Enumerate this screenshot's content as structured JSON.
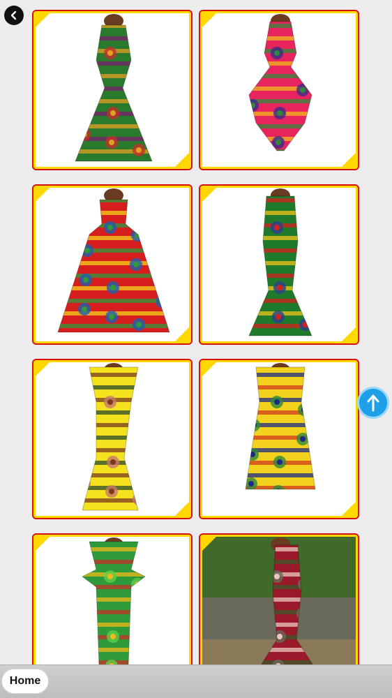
{
  "navigation": {
    "back_icon": "chevron-left-icon",
    "scroll_top_icon": "arrow-up-icon"
  },
  "gallery": {
    "items": [
      {
        "id": "dress-1",
        "palette": [
          "#2a7a2e",
          "#e0a024",
          "#7a1f6e",
          "#c5302a"
        ]
      },
      {
        "id": "dress-2",
        "palette": [
          "#e8245e",
          "#2e8a3a",
          "#f2b81c",
          "#3a2a8a"
        ]
      },
      {
        "id": "dress-3",
        "palette": [
          "#d61e1e",
          "#2f9a3c",
          "#f4d21a",
          "#1e5fb0"
        ]
      },
      {
        "id": "dress-4",
        "palette": [
          "#1f7a2b",
          "#d6221e",
          "#f1c51b",
          "#2a3f8f"
        ]
      },
      {
        "id": "dress-5",
        "palette": [
          "#f4e21e",
          "#7a3a1f",
          "#2a4a2a",
          "#c8786a"
        ]
      },
      {
        "id": "dress-6",
        "palette": [
          "#f2d21c",
          "#1c2a8a",
          "#d03a1e",
          "#2e8a3a"
        ]
      },
      {
        "id": "dress-7",
        "palette": [
          "#2e9a3a",
          "#f2b81c",
          "#c5302a",
          "#5ad04a"
        ]
      },
      {
        "id": "dress-8",
        "palette": [
          "#9a1a2a",
          "#e8c8c0",
          "#3a5a2a",
          "#6a6a5a"
        ]
      }
    ]
  },
  "colors": {
    "card_border": "#d8100a",
    "card_accent": "#ffd800",
    "scroll_button": "#1ea0e8",
    "bottom_bar": "#c6c6c6"
  },
  "bottom_bar": {
    "home_label": "Home"
  }
}
